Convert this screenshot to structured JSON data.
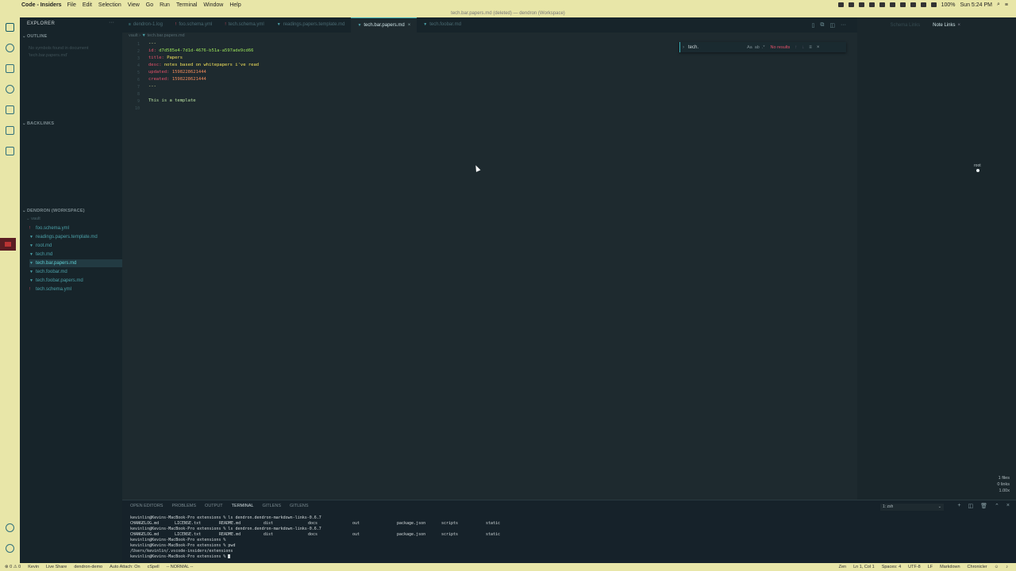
{
  "menubar": {
    "app_name": "Code - Insiders",
    "items": [
      "File",
      "Edit",
      "Selection",
      "View",
      "Go",
      "Run",
      "Terminal",
      "Window",
      "Help"
    ],
    "battery": "100%",
    "clock": "Sun 5:24 PM"
  },
  "window_title": "tech.bar.papers.md (deleted) — dendron (Workspace)",
  "sidebar": {
    "title": "EXPLORER",
    "outline_header": "OUTLINE",
    "outline_empty": "No symbols found in document",
    "outline_doc": "'tech.bar.papers.md'",
    "backlinks_header": "BACKLINKS",
    "workspace_header": "DENDRON (WORKSPACE)",
    "vault": "vault",
    "files": [
      {
        "name": "foo.schema.yml",
        "type": "yml"
      },
      {
        "name": "readings.papers.template.md",
        "type": "md"
      },
      {
        "name": "root.md",
        "type": "md"
      },
      {
        "name": "tech.md",
        "type": "md"
      },
      {
        "name": "tech.bar.papers.md",
        "type": "md",
        "selected": true
      },
      {
        "name": "tech.foobar.md",
        "type": "md"
      },
      {
        "name": "tech.foobar.papers.md",
        "type": "md"
      },
      {
        "name": "tech.schema.yml",
        "type": "yml"
      }
    ]
  },
  "tabs": [
    {
      "label": "dendron-1.log",
      "type": "log"
    },
    {
      "label": "foo.schema.yml",
      "type": "yml"
    },
    {
      "label": "tech.schema.yml",
      "type": "yml"
    },
    {
      "label": "readings.papers.template.md",
      "type": "md"
    },
    {
      "label": "tech.bar.papers.md",
      "type": "md",
      "active": true
    },
    {
      "label": "tech.foobar.md",
      "type": "md"
    }
  ],
  "breadcrumb": {
    "folder": "vault",
    "file": "tech.bar.papers.md"
  },
  "editor": {
    "line_numbers": [
      "1",
      "2",
      "3",
      "4",
      "5",
      "6",
      "7",
      "8",
      "9",
      "10"
    ],
    "lines": {
      "l1": "---",
      "l2_key": "id: ",
      "l2_val": "d7d585e4-7d1d-4676-b51a-a597ade9cd66",
      "l3_key": "title: ",
      "l3_val": "Papers",
      "l4_key": "desc: ",
      "l4_val": "notes based on whitepapers i've read",
      "l5_key": "updated: ",
      "l5_val": "1598228621444",
      "l6_key": "created: ",
      "l6_val": "1598228621444",
      "l7": "---",
      "l9": "This is a template"
    }
  },
  "find_widget": {
    "query": "tech.",
    "opt_case": "Aa",
    "opt_word": "ab",
    "opt_regex": ".*",
    "result": "No results"
  },
  "right_panel": {
    "tabs": [
      {
        "label": "Schema Links",
        "active": false
      },
      {
        "label": "Note Links",
        "active": true
      }
    ],
    "graph_node": "root",
    "stats": [
      "1 files",
      "0 links",
      "1.00x"
    ]
  },
  "panel": {
    "tabs": [
      "OPEN EDITORS",
      "PROBLEMS",
      "OUTPUT",
      "TERMINAL",
      "GITLENS",
      "GITLENS"
    ],
    "active_tab": "TERMINAL",
    "terminal_select": "1: zsh",
    "terminal": {
      "cmd1": "kevinlin@Kevins-MacBook-Pro extensions % ls dendron.dendron-markdown-links-0.6.7",
      "row1": [
        "CHANGELOG.md",
        "LICENSE.txt",
        "README.md",
        "dist",
        "docs",
        "out",
        "package.json",
        "scripts",
        "static"
      ],
      "cmd2": "kevinlin@Kevins-MacBook-Pro extensions % ls dendron.dendron-markdown-links-0.6.7",
      "row2": [
        "CHANGELOG.md",
        "LICENSE.txt",
        "README.md",
        "dist",
        "docs",
        "out",
        "package.json",
        "scripts",
        "static"
      ],
      "cmd3": "kevinlin@Kevins-MacBook-Pro extensions %",
      "cmd4": "kevinlin@Kevins-MacBook-Pro extensions % pwd",
      "out4": "/Users/kevinlin/.vscode-insiders/extensions",
      "cmd5": "kevinlin@Kevins-MacBook-Pro extensions % "
    }
  },
  "statusbar": {
    "left": [
      "⊗ 0 ⚠ 0",
      "Kevin",
      "Live Share",
      "dendron-demo",
      "Auto Attach: On",
      "cSpell",
      "-- NORMAL --"
    ],
    "right": [
      "Zen",
      "Ln 1, Col 1",
      "Spaces: 4",
      "UTF-8",
      "LF",
      "Markdown",
      "Chronicler"
    ]
  }
}
